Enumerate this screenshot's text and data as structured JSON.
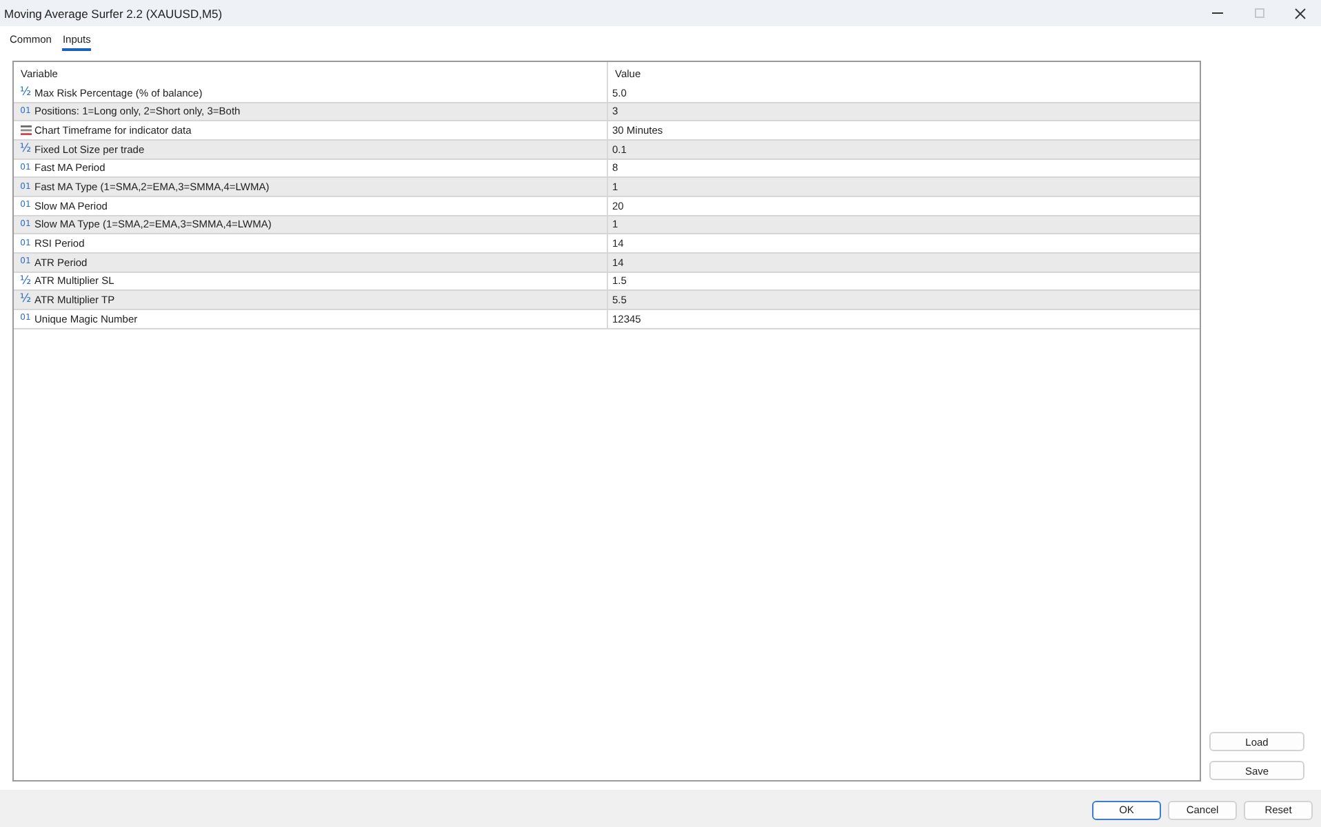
{
  "window": {
    "title": "Moving Average Surfer 2.2 (XAUUSD,M5)",
    "maximize_disabled": true
  },
  "tabs": [
    {
      "label": "Common",
      "selected": false
    },
    {
      "label": "Inputs",
      "selected": true
    }
  ],
  "table": {
    "columns": [
      "Variable",
      "Value"
    ],
    "rows": [
      {
        "kind": "double",
        "type_icon": "½",
        "variable": "Max Risk Percentage (% of balance)",
        "value": "5.0"
      },
      {
        "kind": "int",
        "type_icon": "01",
        "variable": "Positions: 1=Long only, 2=Short only, 3=Both",
        "value": "3"
      },
      {
        "kind": "enum",
        "variable": "Chart Timeframe for indicator data",
        "value": "30 Minutes"
      },
      {
        "kind": "double",
        "type_icon": "½",
        "variable": "Fixed Lot Size per trade",
        "value": "0.1"
      },
      {
        "kind": "int",
        "type_icon": "01",
        "variable": "Fast MA Period",
        "value": "8"
      },
      {
        "kind": "int",
        "type_icon": "01",
        "variable": "Fast MA Type (1=SMA,2=EMA,3=SMMA,4=LWMA)",
        "value": "1"
      },
      {
        "kind": "int",
        "type_icon": "01",
        "variable": "Slow MA Period",
        "value": "20"
      },
      {
        "kind": "int",
        "type_icon": "01",
        "variable": "Slow MA Type (1=SMA,2=EMA,3=SMMA,4=LWMA)",
        "value": "1"
      },
      {
        "kind": "int",
        "type_icon": "01",
        "variable": "RSI Period",
        "value": "14"
      },
      {
        "kind": "int",
        "type_icon": "01",
        "variable": "ATR Period",
        "value": "14"
      },
      {
        "kind": "double",
        "type_icon": "½",
        "variable": "ATR Multiplier SL",
        "value": "1.5"
      },
      {
        "kind": "double",
        "type_icon": "½",
        "variable": "ATR Multiplier TP",
        "value": "5.5"
      },
      {
        "kind": "int",
        "type_icon": "01",
        "variable": "Unique Magic Number",
        "value": "12345"
      }
    ]
  },
  "side_buttons": [
    "Load",
    "Save"
  ],
  "footer_buttons": [
    {
      "label": "OK",
      "default": true
    },
    {
      "label": "Cancel",
      "default": false
    },
    {
      "label": "Reset",
      "default": false
    }
  ]
}
